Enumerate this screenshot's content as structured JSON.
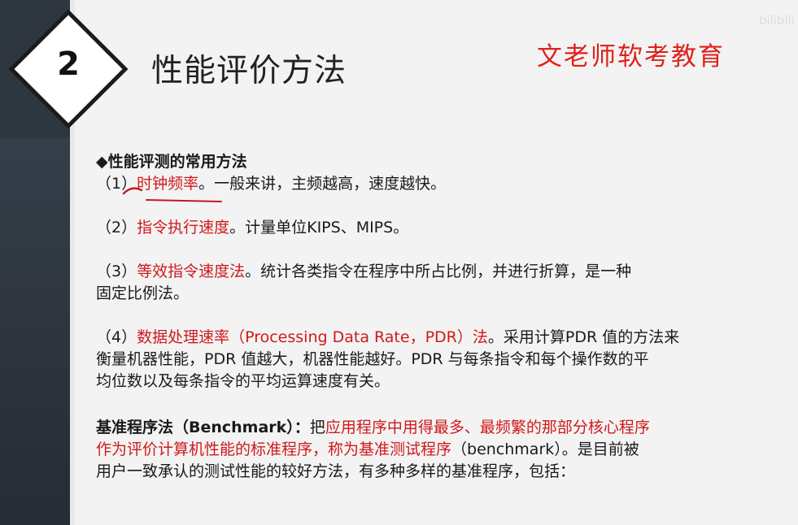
{
  "slide": {
    "section_number": "2",
    "title": "性能评价方法",
    "brand": "文老师软考教育",
    "watermark": "bilibili"
  },
  "content": {
    "heading_bullet": "◆",
    "heading": "性能评测的常用方法",
    "items": [
      {
        "prefix": "（1）",
        "term": "时钟频率",
        "text": "。一般来讲，主频越高，速度越快。"
      },
      {
        "prefix": "（2）",
        "term": "指令执行速度",
        "text": "。计量单位KIPS、MIPS。"
      },
      {
        "prefix": "（3）",
        "term": "等效指令速度法",
        "text_line1": "。统计各类指令在程序中所占比例，并进行折算，是一种",
        "text_line2": "固定比例法。"
      },
      {
        "prefix": "（4）",
        "term": "数据处理速率（Processing Data Rate，PDR）法",
        "text_line1": "。采用计算PDR 值的方法来",
        "text_line2": "衡量机器性能，PDR 值越大，机器性能越好。PDR 与每条指令和每个操作数的平",
        "text_line3": "均位数以及每条指令的平均运算速度有关。"
      }
    ],
    "benchmark": {
      "label": "基准程序法（Benchmark）：",
      "lead": "把",
      "red_line1": "应用程序中用得最多、最频繁的那部分核心程序",
      "red_line2": "作为评价计算机性能的标准程序，称为基准测试程序",
      "rest_line2": "（benchmark）。是目前被",
      "line3": "用户一致承认的测试性能的较好方法，有多种多样的基准程序，包括："
    }
  },
  "colors": {
    "accent_red": "#d0191b",
    "brand_red": "#e0201b",
    "sidebar": "#2e3640"
  }
}
